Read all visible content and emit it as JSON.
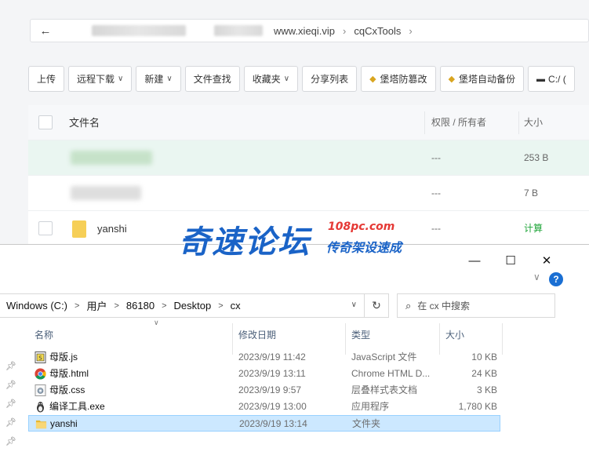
{
  "web": {
    "address": {
      "back_icon": "back-arrow-icon",
      "crumbs": [
        "www.xieqi.vip",
        "cqCxTools"
      ]
    },
    "toolbar": {
      "upload": "上传",
      "remote_download": "远程下载",
      "new": "新建",
      "file_search": "文件查找",
      "favorites": "收藏夹",
      "share_list": "分享列表",
      "tamper_proof": "堡塔防篡改",
      "auto_backup": "堡塔自动备份",
      "drive": "C:/ ("
    },
    "table": {
      "headers": {
        "name": "文件名",
        "perm": "权限 / 所有者",
        "size": "大小"
      },
      "rows": [
        {
          "name": "",
          "perm": "---",
          "size": "253 B"
        },
        {
          "name": "",
          "perm": "---",
          "size": "7 B"
        },
        {
          "name": "yanshi",
          "perm": "---",
          "size": "计算"
        }
      ]
    }
  },
  "watermark": {
    "main": "奇速论坛",
    "url": "108pc.com",
    "slogan": "传奇架设速成"
  },
  "explorer": {
    "controls": {
      "minimize": "—",
      "maximize": "☐",
      "close": "✕"
    },
    "path": {
      "segments": [
        "Windows (C:)",
        "用户",
        "86180",
        "Desktop",
        "cx"
      ]
    },
    "search": {
      "placeholder": "在 cx 中搜索"
    },
    "columns": {
      "name": "名称",
      "date": "修改日期",
      "type": "类型",
      "size": "大小"
    },
    "files": [
      {
        "icon": "js-file-icon",
        "name": "母版.js",
        "date": "2023/9/19 11:42",
        "type": "JavaScript 文件",
        "size": "10 KB"
      },
      {
        "icon": "chrome-html-icon",
        "name": "母版.html",
        "date": "2023/9/19 13:11",
        "type": "Chrome HTML D...",
        "size": "24 KB"
      },
      {
        "icon": "css-file-icon",
        "name": "母版.css",
        "date": "2023/9/19 9:57",
        "type": "层叠样式表文档",
        "size": "3 KB"
      },
      {
        "icon": "exe-app-icon",
        "name": "编译工具.exe",
        "date": "2023/9/19 13:00",
        "type": "应用程序",
        "size": "1,780 KB"
      },
      {
        "icon": "folder-icon",
        "name": "yanshi",
        "date": "2023/9/19 13:14",
        "type": "文件夹",
        "size": ""
      }
    ]
  }
}
